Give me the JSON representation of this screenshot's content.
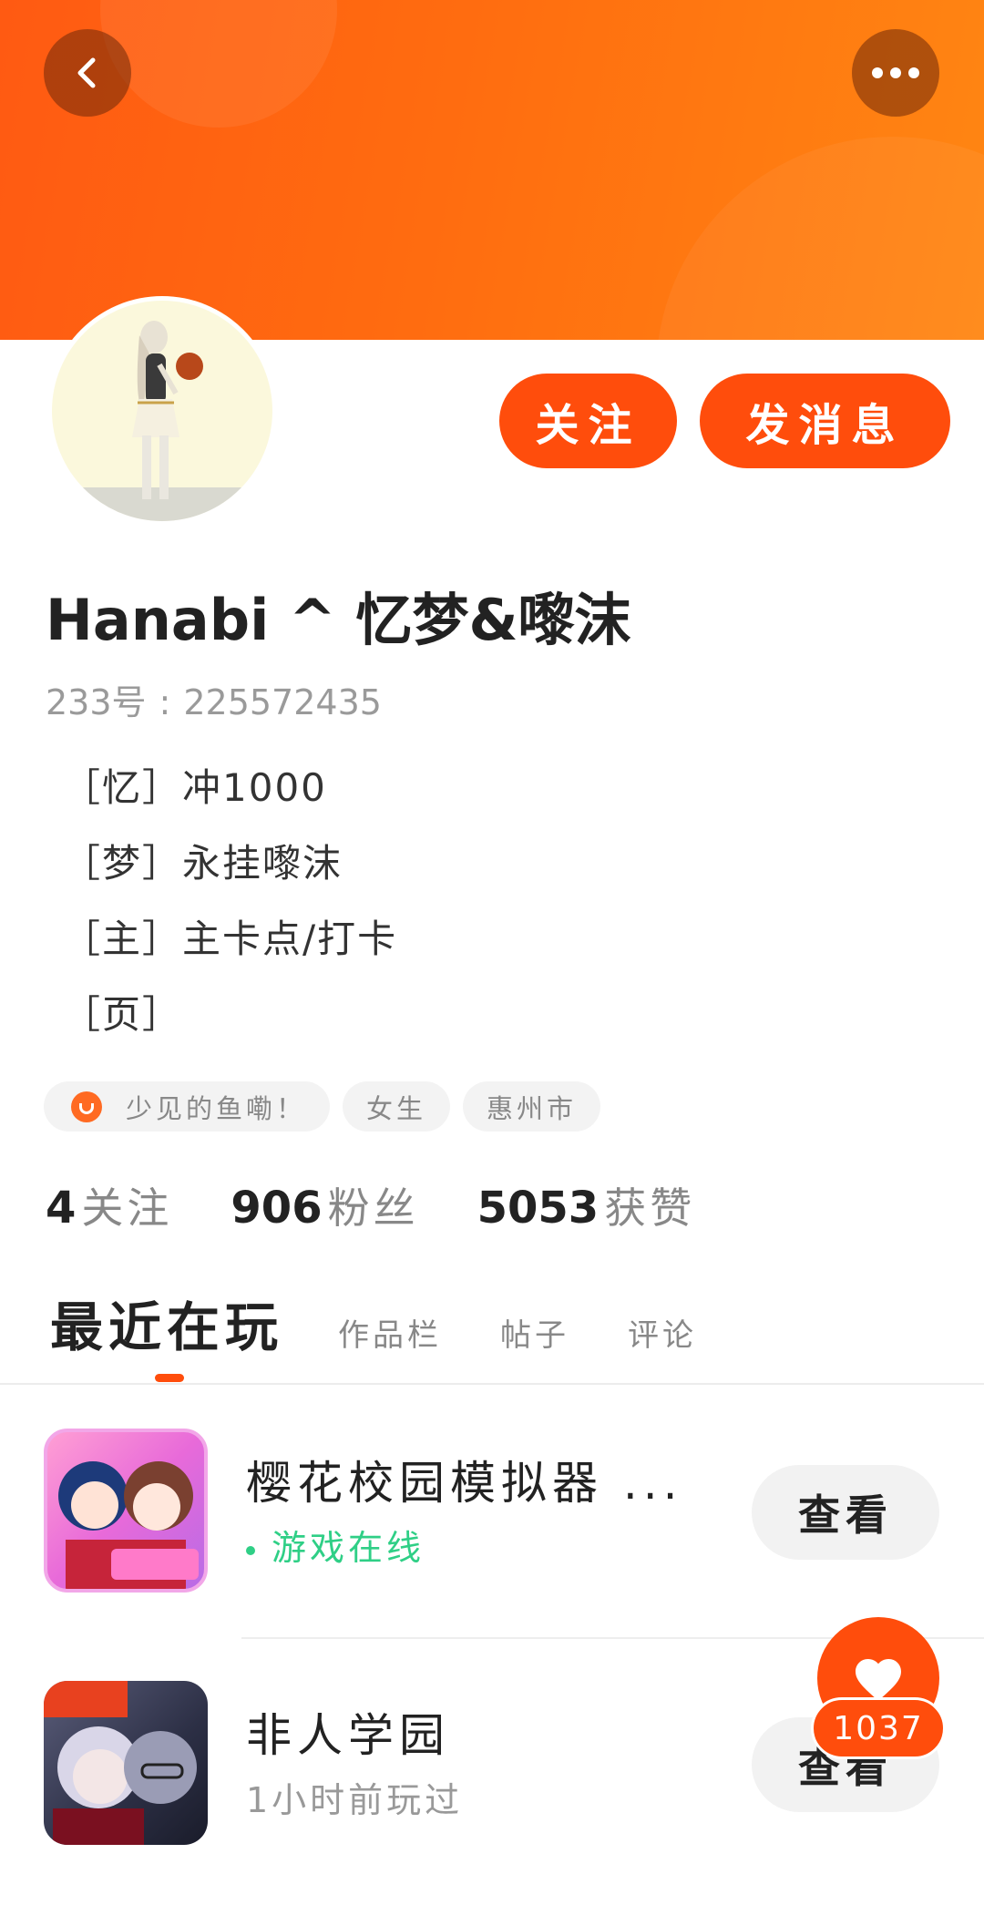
{
  "profile": {
    "username": "Hanabi ^ 忆梦&嚟沫",
    "id_label": "233号",
    "id_value": "225572435",
    "bio": [
      "［忆］冲1000",
      "［梦］永挂嚟沫",
      "［主］主卡点/打卡",
      "［页］"
    ],
    "tags": [
      {
        "label": "少见的鱼嘞！",
        "icon": "level-badge-icon"
      },
      {
        "label": "女生"
      },
      {
        "label": "惠州市"
      }
    ]
  },
  "actions": {
    "follow_label": "关注",
    "message_label": "发消息"
  },
  "stats": [
    {
      "num": "4",
      "label": "关注"
    },
    {
      "num": "906",
      "label": "粉丝"
    },
    {
      "num": "5053",
      "label": "获赞"
    }
  ],
  "tabs": {
    "active": "最近在玩",
    "items": [
      "作品栏",
      "帖子",
      "评论"
    ]
  },
  "games": [
    {
      "title": "樱花校园模拟器 ...",
      "status": "游戏在线",
      "button": "查看"
    },
    {
      "title": "非人学园",
      "status": "1小时前玩过",
      "button": "查看"
    }
  ],
  "like": {
    "count": "1037"
  },
  "colors": {
    "accent": "#ff4d0c",
    "header_start": "#ff5a12",
    "header_end": "#ff8612",
    "online": "#2fcf86"
  }
}
